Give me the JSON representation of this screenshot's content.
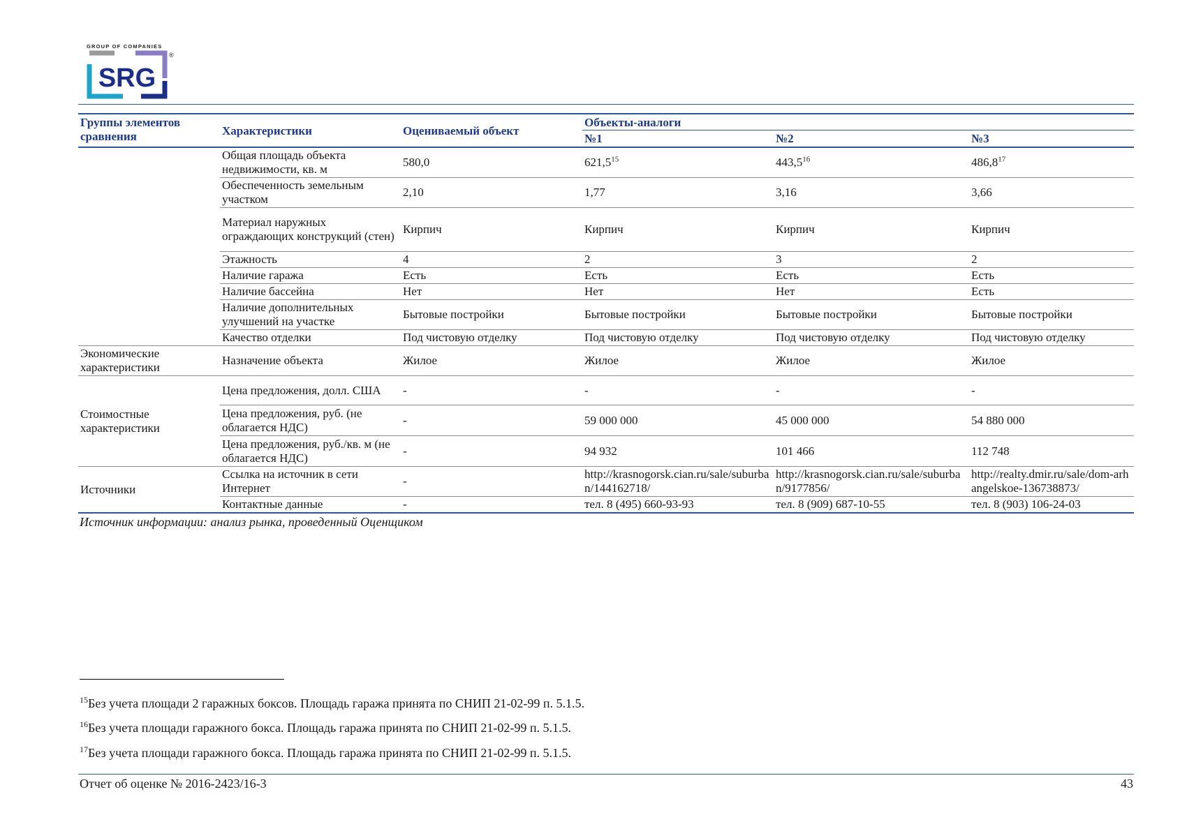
{
  "header": {
    "logo_caption": "GROUP OF COMPANIES",
    "logo_text": "SRG",
    "logo_mark": "®",
    "colors": {
      "cyan": "#1fa3c9",
      "lavender": "#8b7cc4",
      "navy": "#1c2f87",
      "rule": "#2f5496"
    }
  },
  "table": {
    "headers": {
      "group": "Группы элементов сравнения",
      "characteristic": "Характеристики",
      "subject": "Оцениваемый объект",
      "analogs": "Объекты-аналоги",
      "a1": "№1",
      "a2": "№2",
      "a3": "№3"
    },
    "groups": {
      "economic": "Экономические характеристики",
      "cost": "Стоимостные характеристики",
      "sources": "Источники"
    },
    "rows": [
      {
        "name": "Общая площадь объекта недвижимости, кв. м",
        "subject": "580,0",
        "a1": "621,5",
        "a1_sup": "15",
        "a2": "443,5",
        "a2_sup": "16",
        "a3": "486,8",
        "a3_sup": "17"
      },
      {
        "name": "Обеспеченность земельным участком",
        "subject": "2,10",
        "a1": "1,77",
        "a2": "3,16",
        "a3": "3,66"
      },
      {
        "name": "Материал наружных ограждающих конструкций (стен)",
        "subject": "Кирпич",
        "a1": "Кирпич",
        "a2": "Кирпич",
        "a3": "Кирпич"
      },
      {
        "name": "Этажность",
        "subject": "4",
        "a1": "2",
        "a2": "3",
        "a3": "2"
      },
      {
        "name": "Наличие гаража",
        "subject": "Есть",
        "a1": "Есть",
        "a2": "Есть",
        "a3": "Есть"
      },
      {
        "name": "Наличие бассейна",
        "subject": "Нет",
        "a1": "Нет",
        "a2": "Нет",
        "a3": "Есть"
      },
      {
        "name": "Наличие дополнительных улучшений на участке",
        "subject": "Бытовые постройки",
        "a1": "Бытовые постройки",
        "a2": "Бытовые постройки",
        "a3": "Бытовые постройки"
      },
      {
        "name": "Качество отделки",
        "subject": "Под чистовую отделку",
        "a1": "Под чистовую отделку",
        "a2": "Под чистовую отделку",
        "a3": "Под чистовую отделку"
      },
      {
        "name": "Назначение объекта",
        "subject": "Жилое",
        "a1": "Жилое",
        "a2": "Жилое",
        "a3": "Жилое"
      },
      {
        "name": "Цена предложения, долл. США",
        "subject": "-",
        "a1": "-",
        "a2": "-",
        "a3": "-"
      },
      {
        "name": "Цена предложения, руб. (не облагается НДС)",
        "subject": "-",
        "a1": "59 000 000",
        "a2": "45 000 000",
        "a3": "54 880 000"
      },
      {
        "name": "Цена предложения, руб./кв. м (не облагается НДС)",
        "subject": "-",
        "a1": "94 932",
        "a2": "101 466",
        "a3": "112 748"
      },
      {
        "name": "Ссылка на источник в сети Интернет",
        "subject": "-",
        "a1": "http://krasnogorsk.cian.ru/sale/suburban/144162718/",
        "a2": "http://krasnogorsk.cian.ru/sale/suburban/9177856/",
        "a3": "http://realty.dmir.ru/sale/dom-arhangelskoe-136738873/"
      },
      {
        "name": "Контактные данные",
        "subject": "-",
        "a1": "тел. 8 (495) 660-93-93",
        "a2": "тел. 8 (909) 687-10-55",
        "a3": "тел. 8 (903) 106-24-03"
      }
    ]
  },
  "source_note": "Источник информации: анализ рынка, проведенный Оценщиком",
  "footnotes": [
    {
      "num": "15",
      "text": "Без учета площади 2 гаражных боксов. Площадь гаража принята по СНИП 21-02-99 п. 5.1.5."
    },
    {
      "num": "16",
      "text": "Без учета площади гаражного бокса. Площадь гаража принята по СНИП 21-02-99 п. 5.1.5."
    },
    {
      "num": "17",
      "text": "Без учета площади гаражного бокса. Площадь гаража принята по СНИП 21-02-99 п. 5.1.5."
    }
  ],
  "footer": {
    "report": "Отчет об оценке № 2016-2423/16-3",
    "page": "43"
  }
}
